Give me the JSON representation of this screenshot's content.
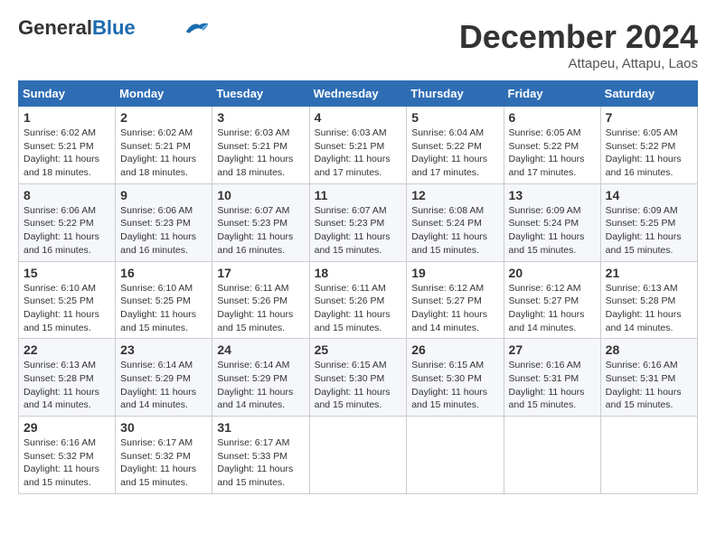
{
  "header": {
    "logo_general": "General",
    "logo_blue": "Blue",
    "month": "December 2024",
    "location": "Attapeu, Attapu, Laos"
  },
  "days_of_week": [
    "Sunday",
    "Monday",
    "Tuesday",
    "Wednesday",
    "Thursday",
    "Friday",
    "Saturday"
  ],
  "weeks": [
    [
      {
        "day": "1",
        "info": "Sunrise: 6:02 AM\nSunset: 5:21 PM\nDaylight: 11 hours\nand 18 minutes."
      },
      {
        "day": "2",
        "info": "Sunrise: 6:02 AM\nSunset: 5:21 PM\nDaylight: 11 hours\nand 18 minutes."
      },
      {
        "day": "3",
        "info": "Sunrise: 6:03 AM\nSunset: 5:21 PM\nDaylight: 11 hours\nand 18 minutes."
      },
      {
        "day": "4",
        "info": "Sunrise: 6:03 AM\nSunset: 5:21 PM\nDaylight: 11 hours\nand 17 minutes."
      },
      {
        "day": "5",
        "info": "Sunrise: 6:04 AM\nSunset: 5:22 PM\nDaylight: 11 hours\nand 17 minutes."
      },
      {
        "day": "6",
        "info": "Sunrise: 6:05 AM\nSunset: 5:22 PM\nDaylight: 11 hours\nand 17 minutes."
      },
      {
        "day": "7",
        "info": "Sunrise: 6:05 AM\nSunset: 5:22 PM\nDaylight: 11 hours\nand 16 minutes."
      }
    ],
    [
      {
        "day": "8",
        "info": "Sunrise: 6:06 AM\nSunset: 5:22 PM\nDaylight: 11 hours\nand 16 minutes."
      },
      {
        "day": "9",
        "info": "Sunrise: 6:06 AM\nSunset: 5:23 PM\nDaylight: 11 hours\nand 16 minutes."
      },
      {
        "day": "10",
        "info": "Sunrise: 6:07 AM\nSunset: 5:23 PM\nDaylight: 11 hours\nand 16 minutes."
      },
      {
        "day": "11",
        "info": "Sunrise: 6:07 AM\nSunset: 5:23 PM\nDaylight: 11 hours\nand 15 minutes."
      },
      {
        "day": "12",
        "info": "Sunrise: 6:08 AM\nSunset: 5:24 PM\nDaylight: 11 hours\nand 15 minutes."
      },
      {
        "day": "13",
        "info": "Sunrise: 6:09 AM\nSunset: 5:24 PM\nDaylight: 11 hours\nand 15 minutes."
      },
      {
        "day": "14",
        "info": "Sunrise: 6:09 AM\nSunset: 5:25 PM\nDaylight: 11 hours\nand 15 minutes."
      }
    ],
    [
      {
        "day": "15",
        "info": "Sunrise: 6:10 AM\nSunset: 5:25 PM\nDaylight: 11 hours\nand 15 minutes."
      },
      {
        "day": "16",
        "info": "Sunrise: 6:10 AM\nSunset: 5:25 PM\nDaylight: 11 hours\nand 15 minutes."
      },
      {
        "day": "17",
        "info": "Sunrise: 6:11 AM\nSunset: 5:26 PM\nDaylight: 11 hours\nand 15 minutes."
      },
      {
        "day": "18",
        "info": "Sunrise: 6:11 AM\nSunset: 5:26 PM\nDaylight: 11 hours\nand 15 minutes."
      },
      {
        "day": "19",
        "info": "Sunrise: 6:12 AM\nSunset: 5:27 PM\nDaylight: 11 hours\nand 14 minutes."
      },
      {
        "day": "20",
        "info": "Sunrise: 6:12 AM\nSunset: 5:27 PM\nDaylight: 11 hours\nand 14 minutes."
      },
      {
        "day": "21",
        "info": "Sunrise: 6:13 AM\nSunset: 5:28 PM\nDaylight: 11 hours\nand 14 minutes."
      }
    ],
    [
      {
        "day": "22",
        "info": "Sunrise: 6:13 AM\nSunset: 5:28 PM\nDaylight: 11 hours\nand 14 minutes."
      },
      {
        "day": "23",
        "info": "Sunrise: 6:14 AM\nSunset: 5:29 PM\nDaylight: 11 hours\nand 14 minutes."
      },
      {
        "day": "24",
        "info": "Sunrise: 6:14 AM\nSunset: 5:29 PM\nDaylight: 11 hours\nand 14 minutes."
      },
      {
        "day": "25",
        "info": "Sunrise: 6:15 AM\nSunset: 5:30 PM\nDaylight: 11 hours\nand 15 minutes."
      },
      {
        "day": "26",
        "info": "Sunrise: 6:15 AM\nSunset: 5:30 PM\nDaylight: 11 hours\nand 15 minutes."
      },
      {
        "day": "27",
        "info": "Sunrise: 6:16 AM\nSunset: 5:31 PM\nDaylight: 11 hours\nand 15 minutes."
      },
      {
        "day": "28",
        "info": "Sunrise: 6:16 AM\nSunset: 5:31 PM\nDaylight: 11 hours\nand 15 minutes."
      }
    ],
    [
      {
        "day": "29",
        "info": "Sunrise: 6:16 AM\nSunset: 5:32 PM\nDaylight: 11 hours\nand 15 minutes."
      },
      {
        "day": "30",
        "info": "Sunrise: 6:17 AM\nSunset: 5:32 PM\nDaylight: 11 hours\nand 15 minutes."
      },
      {
        "day": "31",
        "info": "Sunrise: 6:17 AM\nSunset: 5:33 PM\nDaylight: 11 hours\nand 15 minutes."
      },
      null,
      null,
      null,
      null
    ]
  ]
}
